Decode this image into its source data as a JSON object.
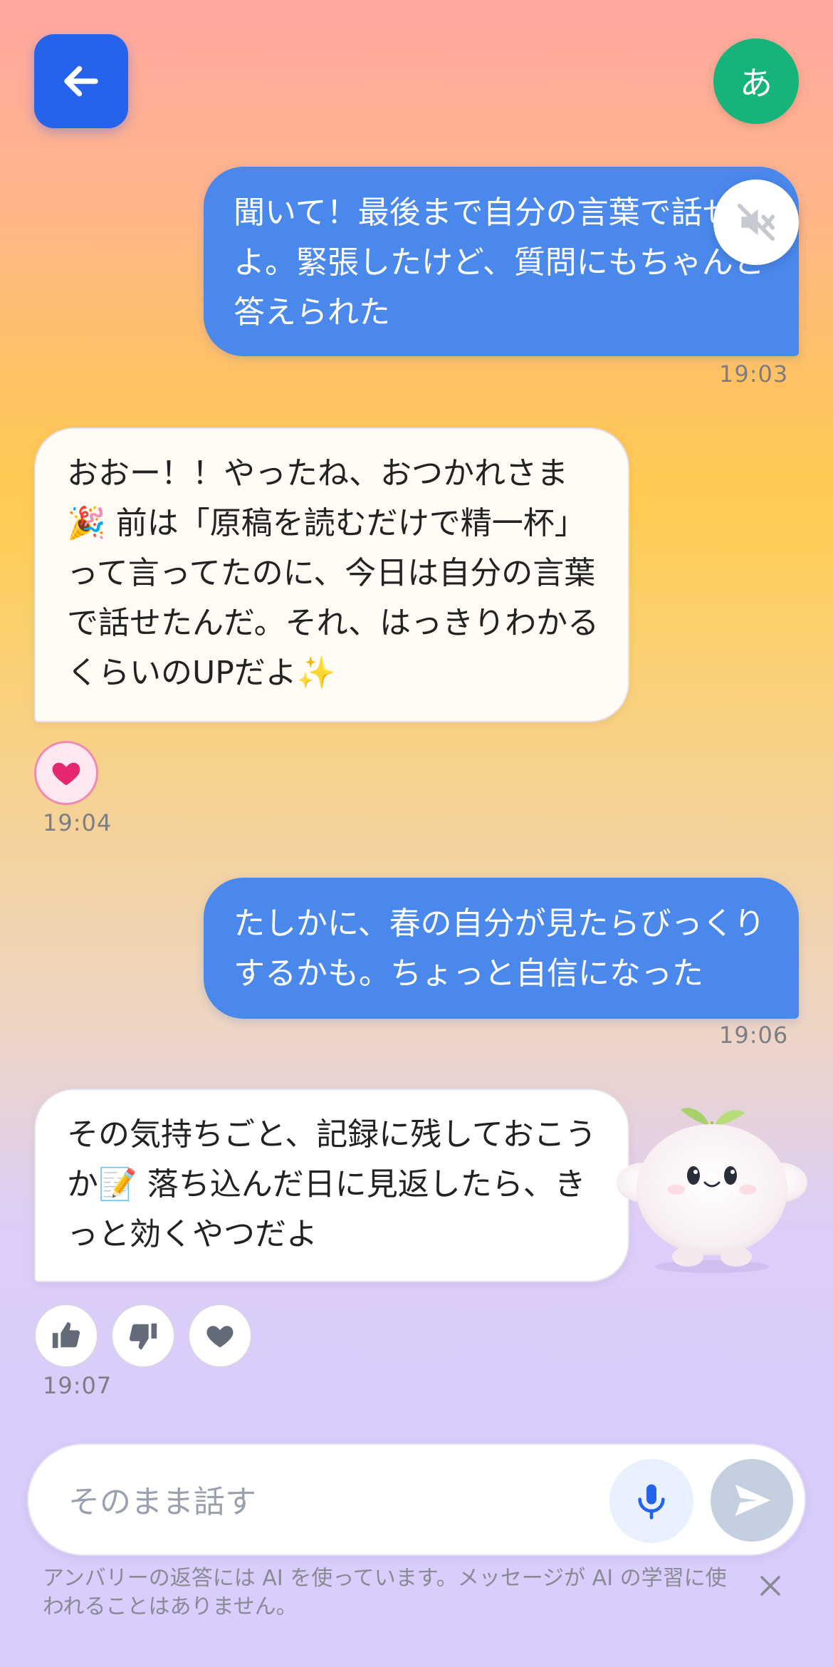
{
  "header": {
    "avatar_initial": "あ"
  },
  "messages": [
    {
      "role": "user",
      "text": "聞いて！最後まで自分の言葉で話せたよ。緊張したけど、質問にもちゃんと答えられた",
      "time": "19:03"
    },
    {
      "role": "bot",
      "text": "おおー！！やったね、おつかれさま🎉 前は「原稿を読むだけで精一杯」って言ってたのに、今日は自分の言葉で話せたんだ。それ、はっきりわかるくらいのUPだよ✨",
      "time": "19:04"
    },
    {
      "role": "user",
      "text": "たしかに、春の自分が見たらびっくりするかも。ちょっと自信になった",
      "time": "19:06"
    },
    {
      "role": "bot",
      "text": "その気持ちごと、記録に残しておこうか📝 落ち込んだ日に見返したら、きっと効くやつだよ",
      "time": "19:07"
    }
  ],
  "composer": {
    "placeholder": "そのまま話す",
    "value": ""
  },
  "disclaimer": "アンバリーの返答には AI を使っています。メッセージが AI の学習に使われることはありません。",
  "colors": {
    "user_bubble": "#4a88ec",
    "back_button": "#2563eb",
    "avatar": "#16b37a",
    "heart": "#e6266f"
  },
  "icons": {
    "back": "arrow-left-icon",
    "mute": "speaker-muted-icon",
    "reaction": "heart-icon",
    "thumbs_up": "thumbs-up-icon",
    "thumbs_down": "thumbs-down-icon",
    "mic": "microphone-icon",
    "send": "send-icon",
    "close": "close-icon"
  }
}
